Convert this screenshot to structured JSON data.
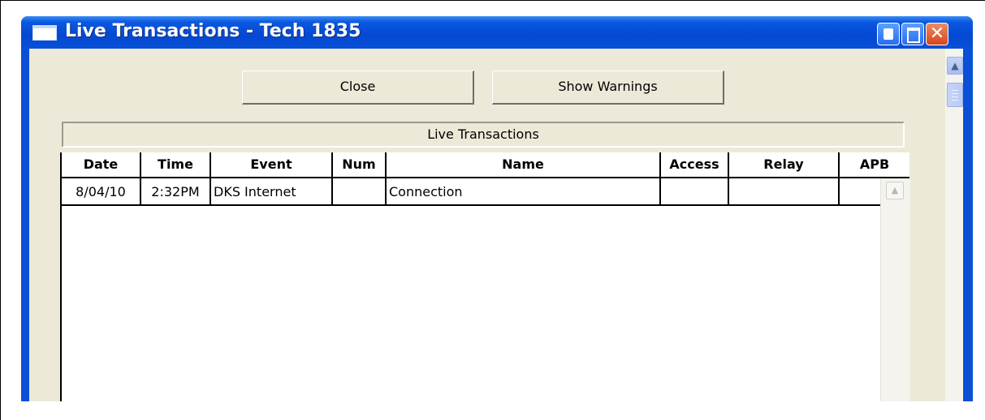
{
  "window": {
    "title": "Live Transactions - Tech 1835",
    "controls": {
      "minimize": "minimize",
      "maximize": "maximize",
      "close": "✕"
    }
  },
  "toolbar": {
    "close_label": "Close",
    "warnings_label": "Show Warnings"
  },
  "grid": {
    "title": "Live Transactions",
    "columns": [
      "Date",
      "Time",
      "Event",
      "Num",
      "Name",
      "Access",
      "Relay",
      "APB"
    ],
    "rows": [
      {
        "date": "8/04/10",
        "time": "2:32PM",
        "event": "DKS Internet",
        "num": "",
        "name": "Connection",
        "access": "",
        "relay": "",
        "apb": ""
      }
    ]
  },
  "icons": {
    "scroll_up": "chevron-up-icon",
    "window": "window-icon"
  },
  "colors": {
    "titlebar": "#0548d2",
    "client": "#ece9d8",
    "close_button": "#d8461e"
  }
}
